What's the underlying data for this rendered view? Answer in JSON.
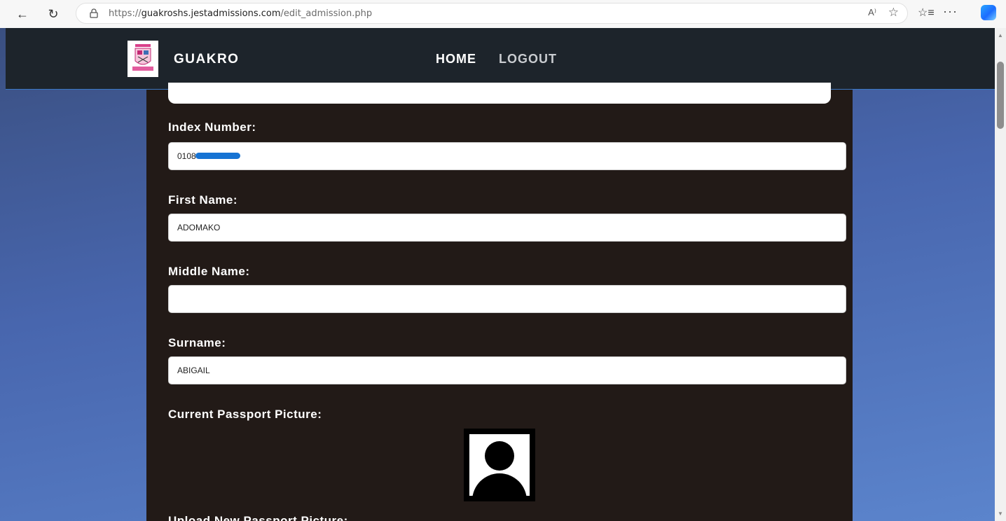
{
  "browser": {
    "url_prefix": "https://",
    "url_host": "guakroshs.jestadmissions.com",
    "url_path": "/edit_admission.php",
    "read_aloud_label": "A⁾"
  },
  "site": {
    "brand": "GUAKRO",
    "nav": {
      "home": "HOME",
      "logout": "LOGOUT"
    }
  },
  "form": {
    "index_number": {
      "label": "Index Number:",
      "value": "0108"
    },
    "first_name": {
      "label": "First Name:",
      "value": "ADOMAKO"
    },
    "middle_name": {
      "label": "Middle Name:",
      "value": ""
    },
    "surname": {
      "label": "Surname:",
      "value": "ABIGAIL"
    },
    "current_passport": {
      "label": "Current Passport Picture:"
    },
    "upload_passport": {
      "label": "Upload New Passport Picture:"
    }
  },
  "colors": {
    "header_bg": "#1d242b",
    "panel_bg": "#221a17",
    "redaction": "#1673d3"
  }
}
